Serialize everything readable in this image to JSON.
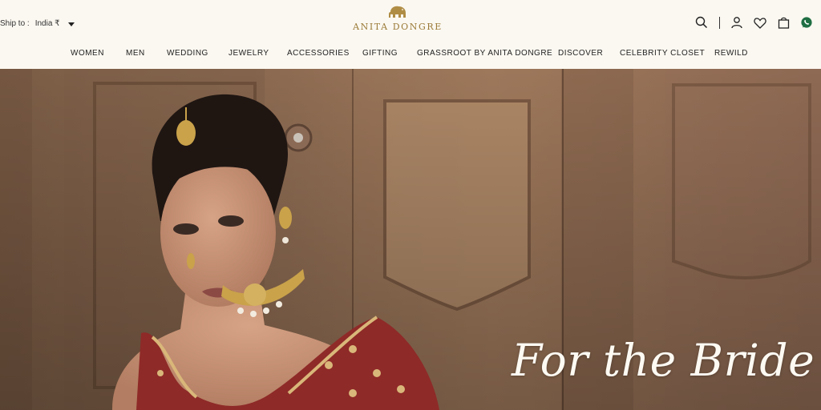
{
  "header": {
    "ship_label": "Ship to :",
    "ship_value": "India ₹",
    "brand": "ANITA DONGRE",
    "logo_icon": "elephant-logo-icon",
    "icons": [
      "search-icon",
      "user-icon",
      "heart-icon",
      "bag-icon",
      "whatsapp-icon"
    ],
    "accent_color": "#9a7a37"
  },
  "nav": {
    "items": [
      "WOMEN",
      "MEN",
      "WEDDING",
      "JEWELRY",
      "ACCESSORIES",
      "GIFTING",
      "GRASSROOT BY ANITA DONGRE",
      "DISCOVER",
      "CELEBRITY CLOSET",
      "REWILD"
    ]
  },
  "hero": {
    "tagline": "For the Bride"
  }
}
